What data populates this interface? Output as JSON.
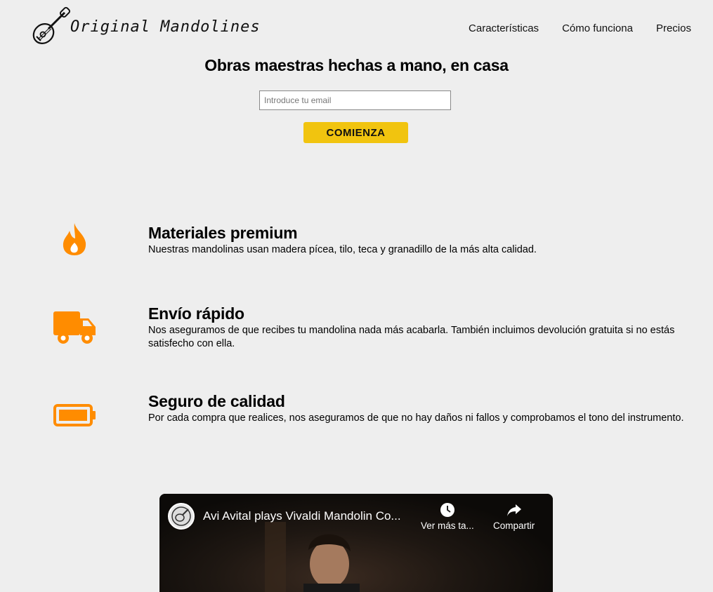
{
  "brand": {
    "name": "Original Mandolines"
  },
  "nav": {
    "items": [
      {
        "label": "Características"
      },
      {
        "label": "Cómo funciona"
      },
      {
        "label": "Precios"
      }
    ]
  },
  "hero": {
    "title": "Obras maestras hechas a mano, en casa",
    "email_placeholder": "Introduce tu email",
    "cta_label": "COMIENZA"
  },
  "features": [
    {
      "icon": "fire-icon",
      "title": "Materiales premium",
      "text": "Nuestras mandolinas usan madera pícea, tilo, teca y granadillo de la más alta calidad."
    },
    {
      "icon": "truck-icon",
      "title": "Envío rápido",
      "text": "Nos aseguramos de que recibes tu mandolina nada más acabarla. También incluimos devolución gratuita si no estás satisfecho con ella."
    },
    {
      "icon": "battery-icon",
      "title": "Seguro de calidad",
      "text": "Por cada compra que realices, nos aseguramos de que no hay daños ni fallos y comprobamos el tono del instrumento."
    }
  ],
  "video": {
    "title": "Avi Avital plays Vivaldi Mandolin Co...",
    "watch_later": "Ver más ta...",
    "share": "Compartir"
  },
  "colors": {
    "accent": "#ff8c00",
    "cta": "#f1c40f",
    "background": "#eeeeee"
  }
}
